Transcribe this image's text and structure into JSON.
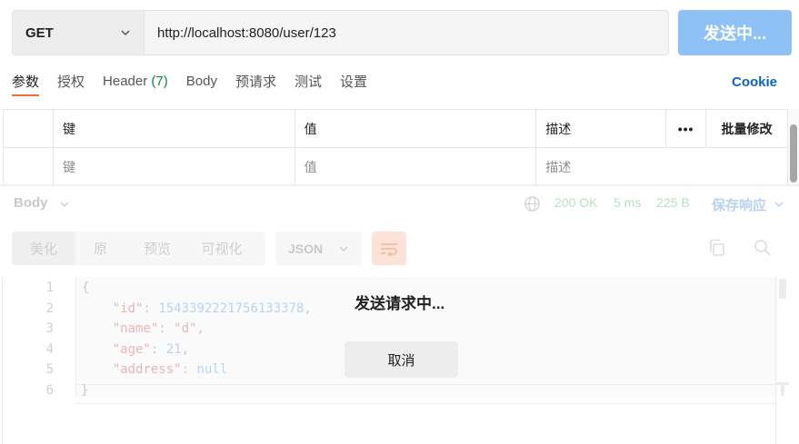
{
  "request": {
    "method": "GET",
    "url": "http://localhost:8080/user/123",
    "send_label": "发送中..."
  },
  "tabs": [
    {
      "label": "参数",
      "active": true
    },
    {
      "label": "授权"
    },
    {
      "label": "Header",
      "count": "(7)"
    },
    {
      "label": "Body"
    },
    {
      "label": "预请求"
    },
    {
      "label": "测试"
    },
    {
      "label": "设置"
    }
  ],
  "cookie_label": "Cookie",
  "params_table": {
    "headers": {
      "key": "键",
      "value": "值",
      "description": "描述",
      "more": "•••",
      "bulk_edit": "批量修改"
    },
    "placeholder_row": {
      "key": "键",
      "value": "值",
      "description": "描述"
    }
  },
  "response": {
    "body_label": "Body",
    "status": "200 OK",
    "time": "5 ms",
    "size": "225 B",
    "save_label": "保存响应",
    "format_buttons": [
      "美化",
      "原",
      "预览",
      "可视化"
    ],
    "format_type": "JSON",
    "lines": [
      "1",
      "2",
      "3",
      "4",
      "5",
      "6"
    ],
    "json": {
      "id_key": "\"id\"",
      "id_val": "1543392221756133378",
      "name_key": "\"name\"",
      "name_val": "\"d\"",
      "age_key": "\"age\"",
      "age_val": "21",
      "address_key": "\"address\"",
      "address_val": "null",
      "open_brace": "{",
      "close_brace": "}"
    }
  },
  "overlay": {
    "message": "发送请求中...",
    "cancel_label": "取消"
  },
  "colors": {
    "send_button": "#8ec1f5",
    "active_tab_underline": "#f26b3a",
    "header_count": "#0d8a3e",
    "cookie_link": "#0b63c4"
  }
}
